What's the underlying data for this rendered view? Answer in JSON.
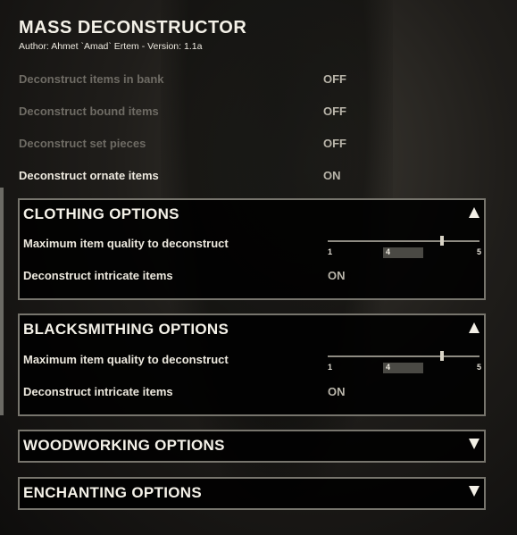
{
  "addon": {
    "title": "MASS DECONSTRUCTOR",
    "subtitle": "Author: Ahmet `Amad` Ertem - Version: 1.1a"
  },
  "settings": [
    {
      "label": "Deconstruct items in bank",
      "value": "OFF",
      "enabled": false
    },
    {
      "label": "Deconstruct bound items",
      "value": "OFF",
      "enabled": false
    },
    {
      "label": "Deconstruct set pieces",
      "value": "OFF",
      "enabled": false
    },
    {
      "label": "Deconstruct ornate items",
      "value": "ON",
      "enabled": true
    }
  ],
  "sections": {
    "clothing": {
      "header": "CLOTHING OPTIONS",
      "expanded": true,
      "quality_label": "Maximum item quality to deconstruct",
      "slider": {
        "min": "1",
        "max": "5",
        "value": "4"
      },
      "intricate_label": "Deconstruct intricate items",
      "intricate_value": "ON"
    },
    "blacksmithing": {
      "header": "BLACKSMITHING OPTIONS",
      "expanded": true,
      "quality_label": "Maximum item quality to deconstruct",
      "slider": {
        "min": "1",
        "max": "5",
        "value": "4"
      },
      "intricate_label": "Deconstruct intricate items",
      "intricate_value": "ON"
    },
    "woodworking": {
      "header": "WOODWORKING OPTIONS",
      "expanded": false
    },
    "enchanting": {
      "header": "ENCHANTING OPTIONS",
      "expanded": false
    }
  },
  "icons": {
    "expand": "triangle-up-icon",
    "collapse": "triangle-down-icon"
  }
}
